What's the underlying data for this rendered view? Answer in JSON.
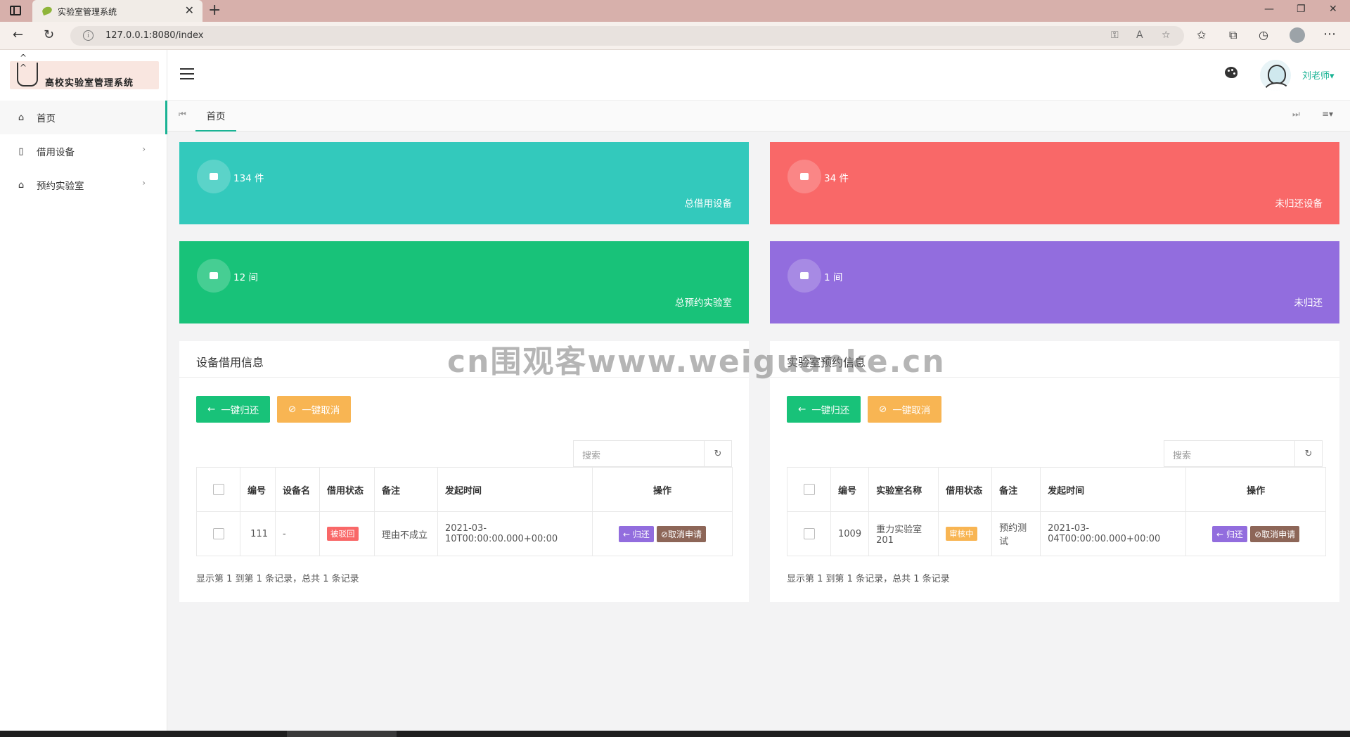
{
  "browser": {
    "tab_title": "实验室管理系统",
    "url": "127.0.0.1:8080/index",
    "new_tab": "+",
    "tab_close": "✕"
  },
  "sidebar": {
    "logo_text": "高校实验室管理系统",
    "items": [
      {
        "label": "首页",
        "icon": "home-icon"
      },
      {
        "label": "借用设备",
        "icon": "book-icon"
      },
      {
        "label": "预约实验室",
        "icon": "house-icon"
      }
    ]
  },
  "header": {
    "user_name": "刘老师▾"
  },
  "page_tabs": {
    "home": "首页"
  },
  "stats": [
    {
      "count": "134 件",
      "label": "总借用设备",
      "color": "#33c9bc"
    },
    {
      "count": "34 件",
      "label": "未归还设备",
      "color": "#f96868"
    },
    {
      "count": "12 间",
      "label": "总预约实验室",
      "color": "#18c279"
    },
    {
      "count": "1 间",
      "label": "未归还",
      "color": "#926dde"
    }
  ],
  "device_panel": {
    "title": "设备借用信息",
    "btn_return": "一键归还",
    "btn_cancel": "一键取消",
    "search_placeholder": "搜索",
    "columns": [
      "编号",
      "设备名",
      "借用状态",
      "备注",
      "发起时间",
      "操作"
    ],
    "row": {
      "id": "111",
      "name": "-",
      "status": "被驳回",
      "remark": "理由不成立",
      "time": "2021-03-10T00:00:00.000+00:00",
      "action_return": "← 归还",
      "action_cancel": "⊘取消申请"
    },
    "summary": "显示第 1 到第 1 条记录，总共 1 条记录"
  },
  "lab_panel": {
    "title": "实验室预约信息",
    "btn_return": "一键归还",
    "btn_cancel": "一键取消",
    "search_placeholder": "搜索",
    "columns": [
      "编号",
      "实验室名称",
      "借用状态",
      "备注",
      "发起时间",
      "操作"
    ],
    "row": {
      "id": "1009",
      "name": "重力实验室201",
      "status": "审核中",
      "remark": "预约测试",
      "time": "2021-03-04T00:00:00.000+00:00",
      "action_return": "← 归还",
      "action_cancel": "⊘取消申请"
    },
    "summary": "显示第 1 到第 1 条记录，总共 1 条记录"
  },
  "watermark": "cn围观客www.weiguanke.cn"
}
